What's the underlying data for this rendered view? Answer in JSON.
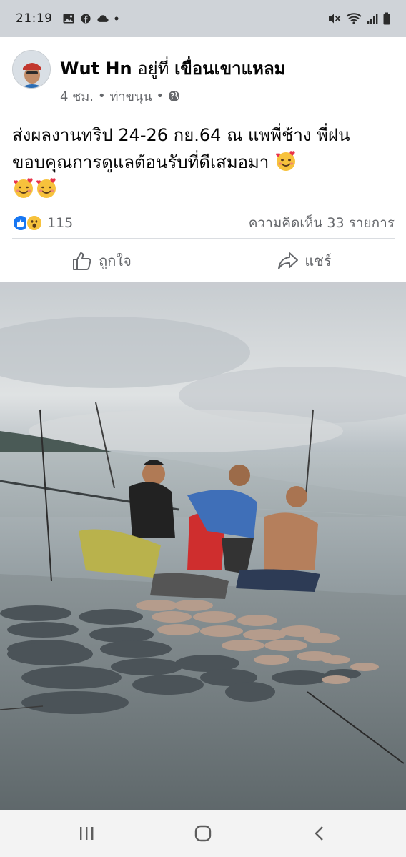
{
  "status_bar": {
    "time": "21:19",
    "left_icons": [
      "image-icon",
      "facebook-icon",
      "cloud-icon",
      "dot-icon"
    ],
    "right_icons": [
      "mute-icon",
      "wifi-icon",
      "signal-icon",
      "battery-icon"
    ]
  },
  "post": {
    "author": "Wut Hn",
    "at_word": "อยู่ที่",
    "location": "เขื่อนเขาแหลม",
    "time_ago": "4 ชม.",
    "separator": "•",
    "place": "ท่าขนุน",
    "privacy_icon": "globe-icon",
    "text": "ส่งผลงานทริป 24-26 กย.64 ณ แพพี่ช้าง พี่ฝน ขอบคุณการดูแลต้อนรับที่ดีเสมอมา",
    "emojis": [
      "smiling-face-with-hearts",
      "smiling-face-with-hearts",
      "smiling-face-with-hearts"
    ],
    "reaction_icons": [
      "like-icon",
      "wow-icon"
    ],
    "reaction_count": "115",
    "comment_count": "ความคิดเห็น 33 รายการ",
    "actions": {
      "like_label": "ถูกใจ",
      "share_label": "แชร์"
    }
  },
  "colors": {
    "accent": "#1877f2",
    "muted_text": "#65676b",
    "status_bar_bg": "#cfd3d8"
  },
  "nav_bar": {
    "buttons": [
      "recent-apps-icon",
      "home-icon",
      "back-icon"
    ]
  }
}
